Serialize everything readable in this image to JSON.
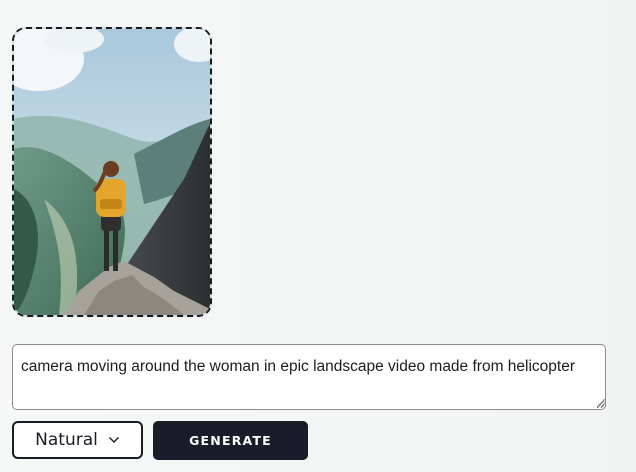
{
  "image_upload": {
    "icon": "landscape-photo"
  },
  "prompt": {
    "value": "camera moving around the woman in epic landscape video made from helicopter",
    "placeholder": ""
  },
  "style_select": {
    "selected": "Natural",
    "icon": "chevron-down-icon"
  },
  "actions": {
    "generate_label": "GENERATE"
  },
  "colors": {
    "button_bg": "#1a1d29",
    "border_dark": "#1a1a1a",
    "page_bg": "#f5f6f6"
  }
}
